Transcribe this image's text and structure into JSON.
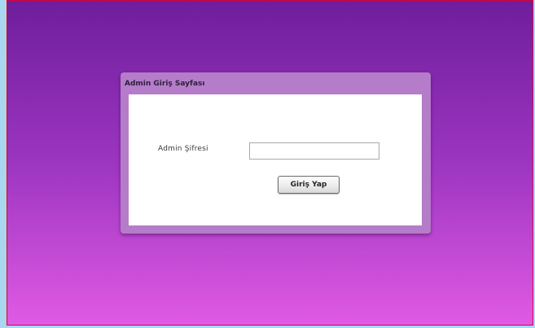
{
  "login_panel": {
    "title": "Admin Giriş Sayfası",
    "password_label": "Admin Şifresi",
    "password_value": "",
    "password_placeholder": "",
    "submit_label": "Giriş Yap"
  }
}
